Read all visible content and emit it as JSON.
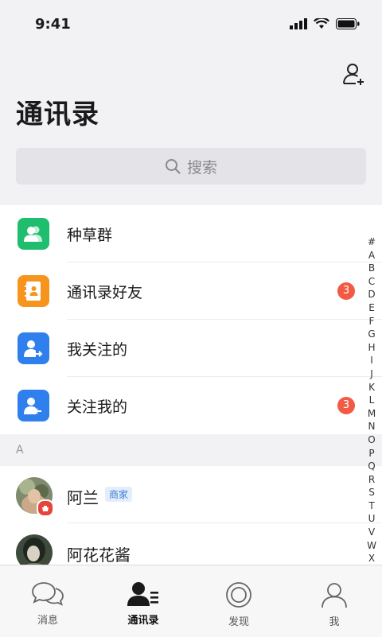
{
  "status_bar": {
    "time": "9:41"
  },
  "header": {
    "title": "通讯录"
  },
  "search": {
    "placeholder": "搜索"
  },
  "menu": [
    {
      "label": "种草群",
      "icon": "group-icon",
      "color": "#1fbe6e",
      "badge": ""
    },
    {
      "label": "通讯录好友",
      "icon": "address-book-icon",
      "color": "#f7941d",
      "badge": "3"
    },
    {
      "label": "我关注的",
      "icon": "following-icon",
      "color": "#2f80ed",
      "badge": ""
    },
    {
      "label": "关注我的",
      "icon": "followers-icon",
      "color": "#2f80ed",
      "badge": "3"
    }
  ],
  "section": {
    "letter": "A"
  },
  "contacts": [
    {
      "name": "阿兰",
      "tag": "商家"
    },
    {
      "name": "阿花花酱",
      "tag": ""
    }
  ],
  "index_letters": [
    "#",
    "A",
    "B",
    "C",
    "D",
    "E",
    "F",
    "G",
    "H",
    "I",
    "J",
    "K",
    "L",
    "M",
    "N",
    "O",
    "P",
    "Q",
    "R",
    "S",
    "T",
    "U",
    "V",
    "W",
    "X"
  ],
  "tabs": [
    {
      "label": "消息",
      "icon": "chat-icon",
      "active": false
    },
    {
      "label": "通讯录",
      "icon": "contacts-icon",
      "active": true
    },
    {
      "label": "发现",
      "icon": "discover-icon",
      "active": false
    },
    {
      "label": "我",
      "icon": "profile-icon",
      "active": false
    }
  ],
  "colors": {
    "accent": "#2f80ed",
    "badge": "#f25a44",
    "green": "#1fbe6e",
    "orange": "#f7941d"
  }
}
